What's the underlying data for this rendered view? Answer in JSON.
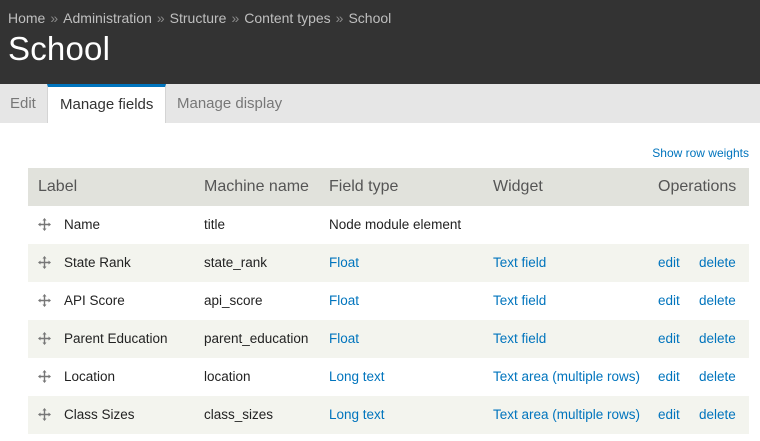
{
  "breadcrumb": {
    "items": [
      "Home",
      "Administration",
      "Structure",
      "Content types",
      "School"
    ],
    "separator": "»"
  },
  "page": {
    "title": "School"
  },
  "tabs": [
    {
      "label": "Edit",
      "active": false
    },
    {
      "label": "Manage fields",
      "active": true
    },
    {
      "label": "Manage display",
      "active": false
    }
  ],
  "show_row_weights": "Show row weights",
  "table": {
    "headers": {
      "label": "Label",
      "machine_name": "Machine name",
      "field_type": "Field type",
      "widget": "Widget",
      "operations": "Operations"
    },
    "rows": [
      {
        "label": "Name",
        "machine_name": "title",
        "field_type": "Node module element",
        "widget": "",
        "edit": "",
        "delete": ""
      },
      {
        "label": "State Rank",
        "machine_name": "state_rank",
        "field_type": "Float",
        "widget": "Text field",
        "edit": "edit",
        "delete": "delete"
      },
      {
        "label": "API Score",
        "machine_name": "api_score",
        "field_type": "Float",
        "widget": "Text field",
        "edit": "edit",
        "delete": "delete"
      },
      {
        "label": "Parent Education",
        "machine_name": "parent_education",
        "field_type": "Float",
        "widget": "Text field",
        "edit": "edit",
        "delete": "delete"
      },
      {
        "label": "Location",
        "machine_name": "location",
        "field_type": "Long text",
        "widget": "Text area (multiple rows)",
        "edit": "edit",
        "delete": "delete"
      },
      {
        "label": "Class Sizes",
        "machine_name": "class_sizes",
        "field_type": "Long text",
        "widget": "Text area (multiple rows)",
        "edit": "edit",
        "delete": "delete"
      }
    ]
  },
  "colors": {
    "header_bg": "#333333",
    "tab_bar_bg": "#e6e6e6",
    "active_tab_border": "#0074bd",
    "link": "#0074bd",
    "table_header_bg": "#e1e2dc",
    "row_even_bg": "#f3f4ee"
  },
  "icons": {
    "drag_handle": "move-cross-icon"
  }
}
